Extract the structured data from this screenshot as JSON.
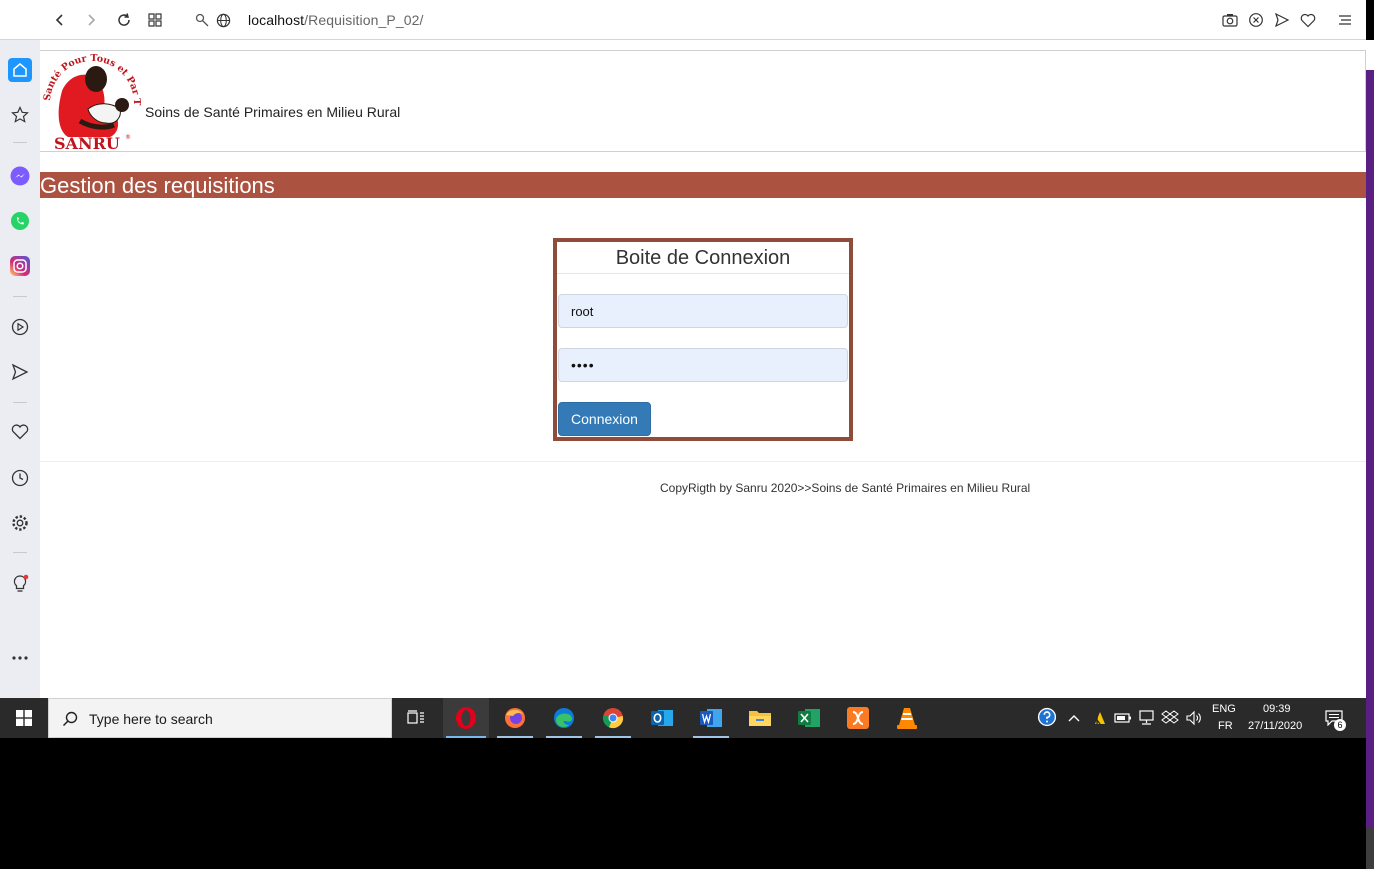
{
  "browser": {
    "url_host": "localhost",
    "url_path": "/Requisition_P_02/",
    "icons": [
      "back-icon",
      "forward-icon",
      "reload-icon",
      "tabs-grid-icon",
      "key-icon",
      "globe-icon",
      "camera-icon",
      "shield-block-icon",
      "send-icon",
      "heart-icon",
      "menu-icon"
    ]
  },
  "sidebar": {
    "items": [
      "home-icon",
      "bookmark-star-icon",
      "messenger-icon",
      "whatsapp-icon",
      "instagram-icon",
      "player-icon",
      "send-icon",
      "heart-icon",
      "history-icon",
      "settings-icon",
      "lightbulb-icon",
      "more-icon"
    ]
  },
  "header": {
    "logo_arc_text": "Santé Pour Tous et Par Tous",
    "logo_brand": "SANRU",
    "subtitle": "Soins de Santé Primaires en Milieu Rural"
  },
  "banner": {
    "title": "Gestion des requisitions"
  },
  "login": {
    "title": "Boite de Connexion",
    "username_value": "root",
    "password_value": "••••",
    "button_label": "Connexion"
  },
  "footer": {
    "text": "CopyRigth by Sanru 2020>>Soins de Santé Primaires en Milieu Rural"
  },
  "taskbar": {
    "search_placeholder": "Type here to search",
    "apps": [
      "opera",
      "firefox",
      "edge",
      "chrome",
      "outlook",
      "word",
      "file-explorer",
      "excel",
      "xampp",
      "vlc"
    ],
    "lang_line1": "ENG",
    "lang_line2": "FR",
    "time": "09:39",
    "date": "27/11/2020",
    "notification_count": "6"
  },
  "colors": {
    "banner": "#ac5240",
    "login_border": "#8f4c3b",
    "button": "#337ab7",
    "input_bg": "#e8f0fe"
  }
}
